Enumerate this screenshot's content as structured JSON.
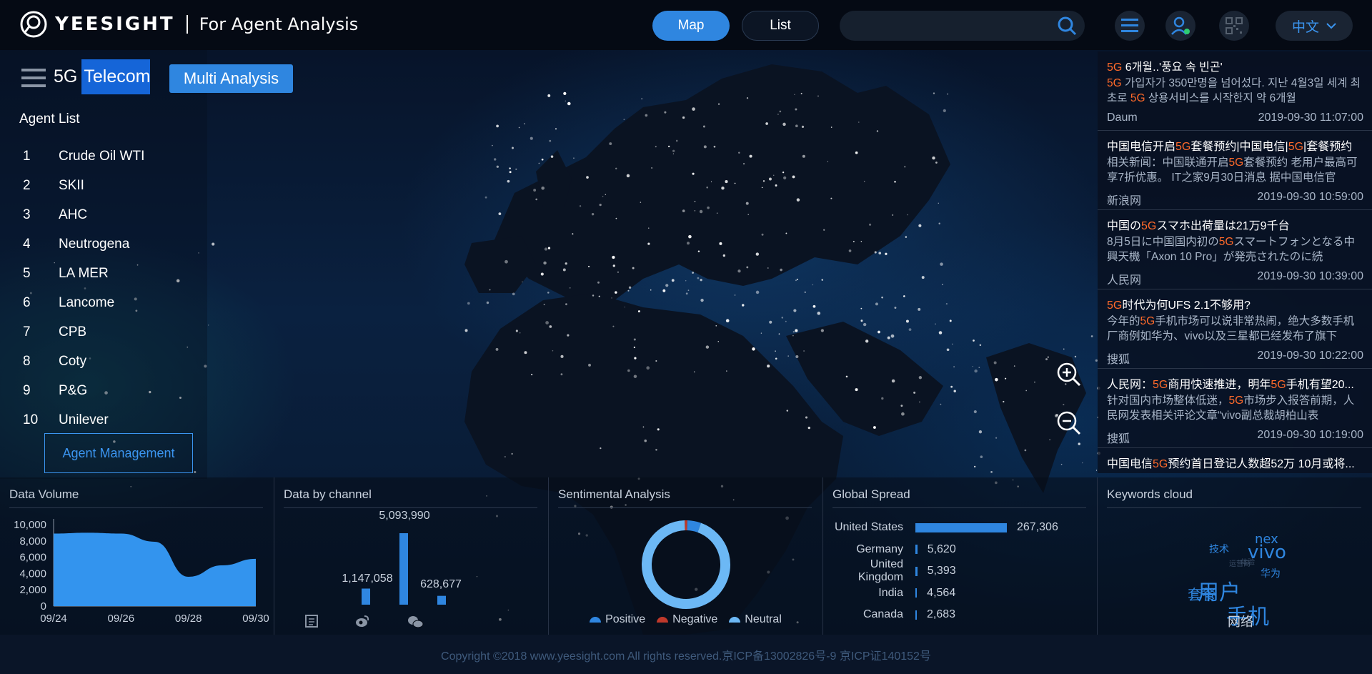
{
  "header": {
    "brand": "YEESIGHT",
    "subtitle": "For Agent Analysis",
    "view_map": "Map",
    "view_list": "List",
    "search_placeholder": "",
    "language": "中文"
  },
  "left": {
    "category_prefix": "5G",
    "category_highlight": "Telecom",
    "multi_analysis": "Multi Analysis",
    "agent_list_title": "Agent List",
    "agents": [
      {
        "num": "1",
        "name": "Crude Oil WTI"
      },
      {
        "num": "2",
        "name": "SKII"
      },
      {
        "num": "3",
        "name": "AHC"
      },
      {
        "num": "4",
        "name": "Neutrogena"
      },
      {
        "num": "5",
        "name": "LA MER"
      },
      {
        "num": "6",
        "name": "Lancome"
      },
      {
        "num": "7",
        "name": "CPB"
      },
      {
        "num": "8",
        "name": "Coty"
      },
      {
        "num": "9",
        "name": "P&G"
      },
      {
        "num": "10",
        "name": "Unilever"
      }
    ],
    "agent_management": "Agent Management"
  },
  "news": [
    {
      "title_parts": [
        "5G",
        " 6개월..'풍요 속 빈곤'"
      ],
      "body_parts": [
        "5G",
        " 가입자가 350만명을 넘어섰다. 지난 4월3일 세계 최초로 ",
        "5G",
        " 상용서비스를 시작한지 약 6개월"
      ],
      "source": "Daum",
      "time": "2019-09-30 11:07:00"
    },
    {
      "title_parts": [
        "中国电信开启",
        "5G",
        "套餐预约|中国电信|",
        "5G",
        "|套餐预约"
      ],
      "body_parts": [
        "相关新闻：中国联通开启",
        "5G",
        "套餐预约 老用户最高可享7折优惠。 IT之家9月30日消息 据中国电信官"
      ],
      "source": "新浪网",
      "time": "2019-09-30 10:59:00"
    },
    {
      "title_parts": [
        "中国の",
        "5G",
        "スマホ出荷量は21万9千台"
      ],
      "body_parts": [
        "8月5日に中国国内初の",
        "5G",
        "スマートフォンとなる中興天機「Axon 10 Pro」が発売されたのに続"
      ],
      "source": "人民网",
      "time": "2019-09-30 10:39:00"
    },
    {
      "title_parts": [
        "5G",
        "时代为何UFS 2.1不够用?"
      ],
      "body_parts": [
        "今年的",
        "5G",
        "手机市场可以说非常热闹，绝大多数手机厂商例如华为、vivo以及三星都已经发布了旗下"
      ],
      "source": "搜狐",
      "time": "2019-09-30 10:22:00"
    },
    {
      "title_parts": [
        "人民网：",
        "5G",
        "商用快速推进，明年",
        "5G",
        "手机有望20..."
      ],
      "body_parts": [
        "针对国内市场整体低迷，",
        "5G",
        "市场步入报答前期，人民网发表相关评论文章“vivo副总裁胡柏山表"
      ],
      "source": "搜狐",
      "time": "2019-09-30 10:19:00"
    },
    {
      "title_parts": [
        "中国电信",
        "5G",
        "预约首日登记人数超52万 10月或将..."
      ],
      "body_parts": [],
      "source": "",
      "time": ""
    }
  ],
  "panels": {
    "data_volume": "Data Volume",
    "data_by_channel": "Data by channel",
    "sentimental": "Sentimental Analysis",
    "global_spread": "Global Spread",
    "keywords": "Keywords cloud"
  },
  "sentiment_legend": {
    "positive": "Positive",
    "negative": "Negative",
    "neutral": "Neutral"
  },
  "keywords": [
    {
      "word": "nex",
      "size": 18
    },
    {
      "word": "vivo",
      "size": 26
    },
    {
      "word": "技术",
      "size": 14
    },
    {
      "word": "运营商",
      "size": 10
    },
    {
      "word": "体验",
      "size": 10
    },
    {
      "word": "华为",
      "size": 14
    },
    {
      "word": "套餐",
      "size": 20
    },
    {
      "word": "用户",
      "size": 30
    },
    {
      "word": "手机",
      "size": 30
    },
    {
      "word": "网络",
      "size": 18
    }
  ],
  "footer": "Copyright ©2018 www.yeesight.com All rights reserved.京ICP备13002826号-9 京ICP证140152号",
  "colors": {
    "accent": "#2f86e0",
    "highlight": "#ff6a2a",
    "negative": "#c0392b"
  },
  "chart_data": [
    {
      "type": "area",
      "x": [
        "09/24",
        "09/25",
        "09/26",
        "09/27",
        "09/28",
        "09/29",
        "09/30"
      ],
      "values": [
        8900,
        9000,
        8900,
        7900,
        3600,
        5000,
        5800
      ],
      "xticks": [
        "09/24",
        "09/26",
        "09/28",
        "09/30"
      ],
      "yticks": [
        "0",
        "2,000",
        "4,000",
        "6,000",
        "8,000",
        "10,000"
      ],
      "ylim": [
        0,
        10000
      ]
    },
    {
      "type": "bar",
      "categories": [
        "news-icon",
        "weibo-icon",
        "wechat-icon"
      ],
      "series": [
        {
          "values": [
            1147058,
            5093990,
            628677
          ],
          "labels": [
            "1,147,058",
            "5,093,990",
            "628,677"
          ]
        }
      ]
    },
    {
      "type": "pie",
      "categories": [
        "Positive",
        "Negative",
        "Neutral"
      ],
      "values": [
        5,
        1,
        94
      ]
    },
    {
      "type": "bar",
      "orientation": "horizontal",
      "categories": [
        "United States",
        "Germany",
        "United Kingdom",
        "India",
        "Canada"
      ],
      "values": [
        267306,
        5620,
        5393,
        4564,
        2683
      ],
      "labels": [
        "267,306",
        "5,620",
        "5,393",
        "4,564",
        "2,683"
      ]
    }
  ]
}
